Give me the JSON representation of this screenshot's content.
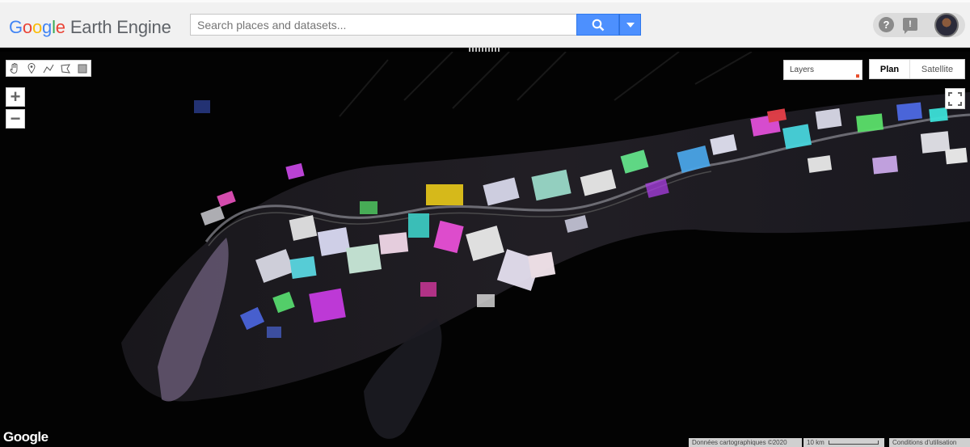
{
  "app": {
    "logo_letters": [
      "G",
      "o",
      "o",
      "g",
      "l",
      "e"
    ],
    "logo_rest": "Earth Engine"
  },
  "search": {
    "placeholder": "Search places and datasets..."
  },
  "header_icons": {
    "help": "?",
    "feedback": "!"
  },
  "map": {
    "layers_label": "Layers",
    "maptype_plan": "Plan",
    "maptype_satellite": "Satellite",
    "zoom_in": "+",
    "zoom_out": "−",
    "google_mark": "Google",
    "attribution": "Données cartographiques ©2020",
    "scale_label": "10 km",
    "terms": "Conditions d'utilisation"
  },
  "colors": {
    "accent": "#4d90fe",
    "map_bg": "#030303",
    "layers_mark": "#e8502e"
  },
  "icons": {
    "draw_tools": [
      "pan-hand-icon",
      "point-marker-icon",
      "polyline-icon",
      "polygon-icon",
      "rectangle-icon"
    ]
  }
}
